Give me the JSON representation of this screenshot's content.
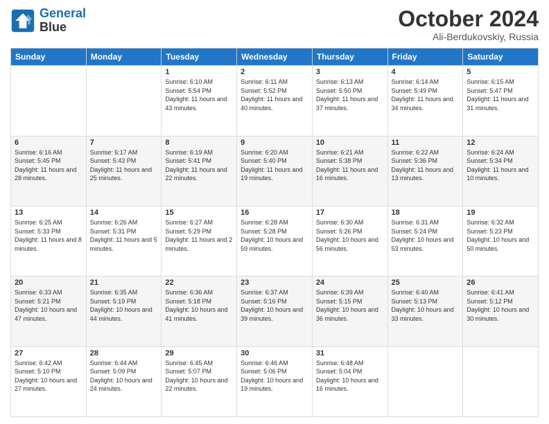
{
  "header": {
    "logo_line1": "General",
    "logo_line2": "Blue",
    "month_title": "October 2024",
    "location": "Ali-Berdukovskiy, Russia"
  },
  "days_of_week": [
    "Sunday",
    "Monday",
    "Tuesday",
    "Wednesday",
    "Thursday",
    "Friday",
    "Saturday"
  ],
  "weeks": [
    [
      {
        "day": "",
        "sunrise": "",
        "sunset": "",
        "daylight": ""
      },
      {
        "day": "",
        "sunrise": "",
        "sunset": "",
        "daylight": ""
      },
      {
        "day": "1",
        "sunrise": "Sunrise: 6:10 AM",
        "sunset": "Sunset: 5:54 PM",
        "daylight": "Daylight: 11 hours and 43 minutes."
      },
      {
        "day": "2",
        "sunrise": "Sunrise: 6:11 AM",
        "sunset": "Sunset: 5:52 PM",
        "daylight": "Daylight: 11 hours and 40 minutes."
      },
      {
        "day": "3",
        "sunrise": "Sunrise: 6:13 AM",
        "sunset": "Sunset: 5:50 PM",
        "daylight": "Daylight: 11 hours and 37 minutes."
      },
      {
        "day": "4",
        "sunrise": "Sunrise: 6:14 AM",
        "sunset": "Sunset: 5:49 PM",
        "daylight": "Daylight: 11 hours and 34 minutes."
      },
      {
        "day": "5",
        "sunrise": "Sunrise: 6:15 AM",
        "sunset": "Sunset: 5:47 PM",
        "daylight": "Daylight: 11 hours and 31 minutes."
      }
    ],
    [
      {
        "day": "6",
        "sunrise": "Sunrise: 6:16 AM",
        "sunset": "Sunset: 5:45 PM",
        "daylight": "Daylight: 11 hours and 28 minutes."
      },
      {
        "day": "7",
        "sunrise": "Sunrise: 6:17 AM",
        "sunset": "Sunset: 5:43 PM",
        "daylight": "Daylight: 11 hours and 25 minutes."
      },
      {
        "day": "8",
        "sunrise": "Sunrise: 6:19 AM",
        "sunset": "Sunset: 5:41 PM",
        "daylight": "Daylight: 11 hours and 22 minutes."
      },
      {
        "day": "9",
        "sunrise": "Sunrise: 6:20 AM",
        "sunset": "Sunset: 5:40 PM",
        "daylight": "Daylight: 11 hours and 19 minutes."
      },
      {
        "day": "10",
        "sunrise": "Sunrise: 6:21 AM",
        "sunset": "Sunset: 5:38 PM",
        "daylight": "Daylight: 11 hours and 16 minutes."
      },
      {
        "day": "11",
        "sunrise": "Sunrise: 6:22 AM",
        "sunset": "Sunset: 5:36 PM",
        "daylight": "Daylight: 11 hours and 13 minutes."
      },
      {
        "day": "12",
        "sunrise": "Sunrise: 6:24 AM",
        "sunset": "Sunset: 5:34 PM",
        "daylight": "Daylight: 11 hours and 10 minutes."
      }
    ],
    [
      {
        "day": "13",
        "sunrise": "Sunrise: 6:25 AM",
        "sunset": "Sunset: 5:33 PM",
        "daylight": "Daylight: 11 hours and 8 minutes."
      },
      {
        "day": "14",
        "sunrise": "Sunrise: 6:26 AM",
        "sunset": "Sunset: 5:31 PM",
        "daylight": "Daylight: 11 hours and 5 minutes."
      },
      {
        "day": "15",
        "sunrise": "Sunrise: 6:27 AM",
        "sunset": "Sunset: 5:29 PM",
        "daylight": "Daylight: 11 hours and 2 minutes."
      },
      {
        "day": "16",
        "sunrise": "Sunrise: 6:28 AM",
        "sunset": "Sunset: 5:28 PM",
        "daylight": "Daylight: 10 hours and 59 minutes."
      },
      {
        "day": "17",
        "sunrise": "Sunrise: 6:30 AM",
        "sunset": "Sunset: 5:26 PM",
        "daylight": "Daylight: 10 hours and 56 minutes."
      },
      {
        "day": "18",
        "sunrise": "Sunrise: 6:31 AM",
        "sunset": "Sunset: 5:24 PM",
        "daylight": "Daylight: 10 hours and 53 minutes."
      },
      {
        "day": "19",
        "sunrise": "Sunrise: 6:32 AM",
        "sunset": "Sunset: 5:23 PM",
        "daylight": "Daylight: 10 hours and 50 minutes."
      }
    ],
    [
      {
        "day": "20",
        "sunrise": "Sunrise: 6:33 AM",
        "sunset": "Sunset: 5:21 PM",
        "daylight": "Daylight: 10 hours and 47 minutes."
      },
      {
        "day": "21",
        "sunrise": "Sunrise: 6:35 AM",
        "sunset": "Sunset: 5:19 PM",
        "daylight": "Daylight: 10 hours and 44 minutes."
      },
      {
        "day": "22",
        "sunrise": "Sunrise: 6:36 AM",
        "sunset": "Sunset: 5:18 PM",
        "daylight": "Daylight: 10 hours and 41 minutes."
      },
      {
        "day": "23",
        "sunrise": "Sunrise: 6:37 AM",
        "sunset": "Sunset: 5:16 PM",
        "daylight": "Daylight: 10 hours and 39 minutes."
      },
      {
        "day": "24",
        "sunrise": "Sunrise: 6:39 AM",
        "sunset": "Sunset: 5:15 PM",
        "daylight": "Daylight: 10 hours and 36 minutes."
      },
      {
        "day": "25",
        "sunrise": "Sunrise: 6:40 AM",
        "sunset": "Sunset: 5:13 PM",
        "daylight": "Daylight: 10 hours and 33 minutes."
      },
      {
        "day": "26",
        "sunrise": "Sunrise: 6:41 AM",
        "sunset": "Sunset: 5:12 PM",
        "daylight": "Daylight: 10 hours and 30 minutes."
      }
    ],
    [
      {
        "day": "27",
        "sunrise": "Sunrise: 6:42 AM",
        "sunset": "Sunset: 5:10 PM",
        "daylight": "Daylight: 10 hours and 27 minutes."
      },
      {
        "day": "28",
        "sunrise": "Sunrise: 6:44 AM",
        "sunset": "Sunset: 5:09 PM",
        "daylight": "Daylight: 10 hours and 24 minutes."
      },
      {
        "day": "29",
        "sunrise": "Sunrise: 6:45 AM",
        "sunset": "Sunset: 5:07 PM",
        "daylight": "Daylight: 10 hours and 22 minutes."
      },
      {
        "day": "30",
        "sunrise": "Sunrise: 6:46 AM",
        "sunset": "Sunset: 5:06 PM",
        "daylight": "Daylight: 10 hours and 19 minutes."
      },
      {
        "day": "31",
        "sunrise": "Sunrise: 6:48 AM",
        "sunset": "Sunset: 5:04 PM",
        "daylight": "Daylight: 10 hours and 16 minutes."
      },
      {
        "day": "",
        "sunrise": "",
        "sunset": "",
        "daylight": ""
      },
      {
        "day": "",
        "sunrise": "",
        "sunset": "",
        "daylight": ""
      }
    ]
  ]
}
